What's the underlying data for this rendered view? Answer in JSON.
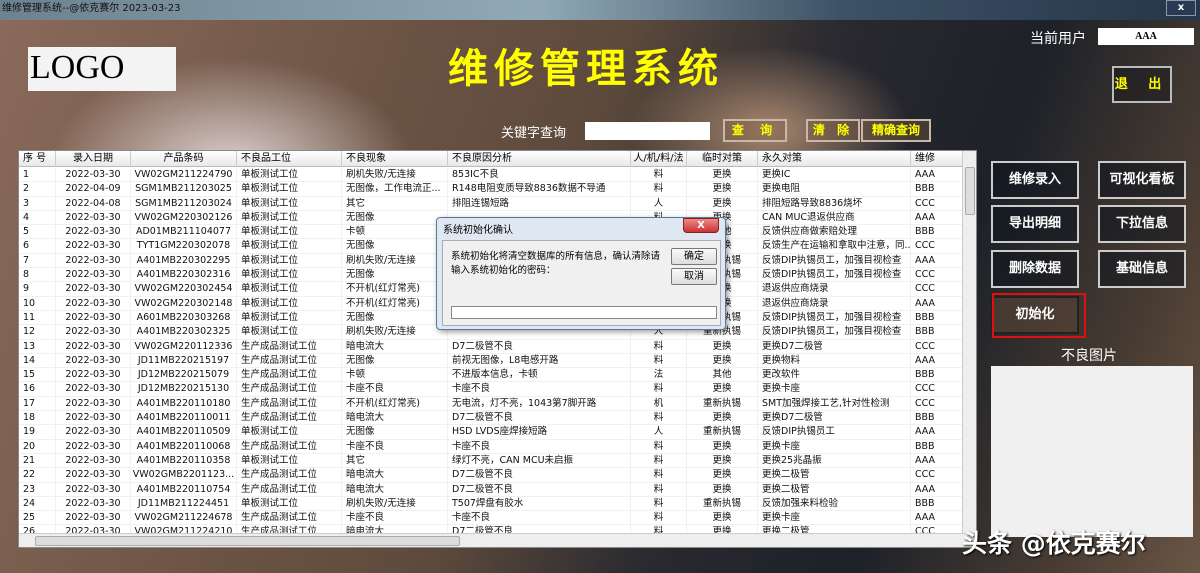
{
  "window": {
    "title": "维修管理系统--@依克赛尔 2023-03-23",
    "close": "x"
  },
  "header": {
    "logo": "LOGO",
    "app_title": "维修管理系统",
    "current_user_label": "当前用户",
    "current_user": "AAA",
    "exit": "退 出"
  },
  "search": {
    "label": "关键字查询",
    "value": "",
    "query": "查 询",
    "clear": "清 除",
    "exact": "精确查询"
  },
  "table": {
    "columns": [
      "序 号",
      "录入日期",
      "产品条码",
      "不良品工位",
      "不良现象",
      "不良原因分析",
      "人/机/料/法",
      "临时对策",
      "永久对策",
      "维修"
    ],
    "rows": [
      [
        "1",
        "2022-03-30",
        "VW02GM211224790",
        "单板测试工位",
        "刷机失败/无连接",
        "853IC不良",
        "料",
        "更换",
        "更换IC",
        "AAA"
      ],
      [
        "2",
        "2022-04-09",
        "SGM1MB211203025",
        "单板测试工位",
        "无图像，工作电流正...",
        "R148电阻变质导致8836数据不导通",
        "料",
        "更换",
        "更换电阻",
        "BBB"
      ],
      [
        "3",
        "2022-04-08",
        "SGM1MB211203024",
        "单板测试工位",
        "其它",
        "排阻连锡短路",
        "人",
        "更换",
        "排阻短路导致8836烧坏",
        "CCC"
      ],
      [
        "4",
        "2022-03-30",
        "VW02GM220302126",
        "单板测试工位",
        "无图像",
        "",
        "料",
        "更换",
        "CAN MUC退返供应商",
        "AAA"
      ],
      [
        "5",
        "2022-03-30",
        "AD01MB211104077",
        "单板测试工位",
        "卡顿",
        "",
        "",
        "其他",
        "反馈供应商做索赔处理",
        "BBB"
      ],
      [
        "6",
        "2022-03-30",
        "TYT1GM220302078",
        "单板测试工位",
        "无图像",
        "",
        "",
        "更换",
        "反馈生产在运输和拿取中注意，同...",
        "CCC"
      ],
      [
        "7",
        "2022-03-30",
        "A401MB220302295",
        "单板测试工位",
        "刷机失败/无连接",
        "",
        "",
        "重新执锡",
        "反馈DIP执锡员工，加强目视检查",
        "AAA"
      ],
      [
        "8",
        "2022-03-30",
        "A401MB220302316",
        "单板测试工位",
        "无图像",
        "",
        "",
        "重新执锡",
        "反馈DIP执锡员工，加强目视检查",
        "CCC"
      ],
      [
        "9",
        "2022-03-30",
        "VW02GM220302454",
        "单板测试工位",
        "不开机(红灯常亮)",
        "",
        "",
        "更换",
        "退返供应商烧录",
        "CCC"
      ],
      [
        "10",
        "2022-03-30",
        "VW02GM220302148",
        "单板测试工位",
        "不开机(红灯常亮)",
        "",
        "",
        "更换",
        "退返供应商烧录",
        "AAA"
      ],
      [
        "11",
        "2022-03-30",
        "A601MB220303268",
        "单板测试工位",
        "无图像",
        "",
        "",
        "重新执锡",
        "反馈DIP执锡员工，加强目视检查",
        "BBB"
      ],
      [
        "12",
        "2022-03-30",
        "A401MB220302325",
        "单板测试工位",
        "刷机失败/无连接",
        "",
        "人",
        "重新执锡",
        "反馈DIP执锡员工，加强目视检查",
        "BBB"
      ],
      [
        "13",
        "2022-03-30",
        "VW02GM220112336",
        "生产成品测试工位",
        "暗电流大",
        "D7二极管不良",
        "料",
        "更换",
        "更换D7二极管",
        "CCC"
      ],
      [
        "14",
        "2022-03-30",
        "JD11MB220215197",
        "生产成品测试工位",
        "无图像",
        "前视无图像，L8电感开路",
        "料",
        "更换",
        "更换物料",
        "AAA"
      ],
      [
        "15",
        "2022-03-30",
        "JD12MB220215079",
        "生产成品测试工位",
        "卡顿",
        "不进版本信息，卡顿",
        "法",
        "其他",
        "更改软件",
        "BBB"
      ],
      [
        "16",
        "2022-03-30",
        "JD12MB220215130",
        "生产成品测试工位",
        "卡座不良",
        "卡座不良",
        "料",
        "更换",
        "更换卡座",
        "CCC"
      ],
      [
        "17",
        "2022-03-30",
        "A401MB220110180",
        "生产成品测试工位",
        "不开机(红灯常亮)",
        "无电流，灯不亮，1043第7脚开路",
        "机",
        "重新执锡",
        "SMT加强焊接工艺,针对性检测",
        "CCC"
      ],
      [
        "18",
        "2022-03-30",
        "A401MB220110011",
        "生产成品测试工位",
        "暗电流大",
        "D7二极管不良",
        "料",
        "更换",
        "更换D7二极管",
        "BBB"
      ],
      [
        "19",
        "2022-03-30",
        "A401MB220110509",
        "单板测试工位",
        "无图像",
        "HSD LVDS座焊接短路",
        "人",
        "重新执锡",
        "反馈DIP执锡员工",
        "AAA"
      ],
      [
        "20",
        "2022-03-30",
        "A401MB220110068",
        "生产成品测试工位",
        "卡座不良",
        "卡座不良",
        "料",
        "更换",
        "更换卡座",
        "BBB"
      ],
      [
        "21",
        "2022-03-30",
        "A401MB220110358",
        "单板测试工位",
        "其它",
        "绿灯不亮，CAN MCU未启振",
        "料",
        "更换",
        "更换25兆晶振",
        "AAA"
      ],
      [
        "22",
        "2022-03-30",
        "VW02GMB2201123...",
        "生产成品测试工位",
        "暗电流大",
        "D7二极管不良",
        "料",
        "更换",
        "更换二极管",
        "CCC"
      ],
      [
        "23",
        "2022-03-30",
        "A401MB220110754",
        "生产成品测试工位",
        "暗电流大",
        "D7二极管不良",
        "料",
        "更换",
        "更换二极管",
        "AAA"
      ],
      [
        "24",
        "2022-03-30",
        "JD11MB211224451",
        "单板测试工位",
        "刷机失败/无连接",
        "T507焊盘有胶水",
        "料",
        "重新执锡",
        "反馈加强来料检验",
        "BBB"
      ],
      [
        "25",
        "2022-03-30",
        "VW02GM211224678",
        "生产成品测试工位",
        "卡座不良",
        "卡座不良",
        "料",
        "更换",
        "更换卡座",
        "AAA"
      ],
      [
        "26",
        "2022-03-30",
        "VW02GM211224210",
        "生产成品测试工位",
        "暗电流大",
        "D7二极管不良",
        "料",
        "更换",
        "更换二极管",
        "CCC"
      ]
    ]
  },
  "actions": {
    "repair_entry": "维修录入",
    "dashboard": "可视化看板",
    "export": "导出明细",
    "dropdown_info": "下拉信息",
    "delete": "删除数据",
    "base_info": "基础信息",
    "init": "初始化"
  },
  "picture": {
    "label": "不良图片"
  },
  "dialog": {
    "title": "系统初始化确认",
    "message": "系统初始化将清空数据库的所有信息，确认清除请输入系统初始化的密码：",
    "ok": "确定",
    "cancel": "取消",
    "close": "X",
    "input": ""
  },
  "watermark": "头条 @依克赛尔"
}
